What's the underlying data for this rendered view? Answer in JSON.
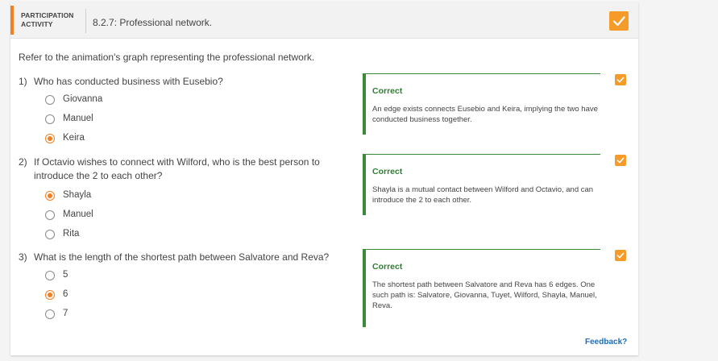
{
  "header": {
    "participation_line1": "PARTICIPATION",
    "participation_line2": "ACTIVITY",
    "title": "8.2.7: Professional network."
  },
  "intro": "Refer to the animation's graph representing the professional network.",
  "questions": [
    {
      "number": "1)",
      "text": "Who has conducted business with Eusebio?",
      "options": [
        {
          "label": "Giovanna",
          "selected": false
        },
        {
          "label": "Manuel",
          "selected": false
        },
        {
          "label": "Keira",
          "selected": true
        }
      ],
      "feedback": {
        "title": "Correct",
        "body": "An edge exists connects Eusebio and Keira, implying the two have conducted business together."
      }
    },
    {
      "number": "2)",
      "text": "If Octavio wishes to connect with Wilford, who is the best person to introduce the 2 to each other?",
      "options": [
        {
          "label": "Shayla",
          "selected": true
        },
        {
          "label": "Manuel",
          "selected": false
        },
        {
          "label": "Rita",
          "selected": false
        }
      ],
      "feedback": {
        "title": "Correct",
        "body": "Shayla is a mutual contact between Wilford and Octavio, and can introduce the 2 to each other."
      }
    },
    {
      "number": "3)",
      "text": "What is the length of the shortest path between Salvatore and Reva?",
      "options": [
        {
          "label": "5",
          "selected": false
        },
        {
          "label": "6",
          "selected": true
        },
        {
          "label": "7",
          "selected": false
        }
      ],
      "feedback": {
        "title": "Correct",
        "body": "The shortest path between Salvatore and Reva has 6 edges. One such path is: Salvatore, Giovanna, Tuyet, Wilford, Shayla, Manuel, Reva."
      }
    }
  ],
  "feedback_link": "Feedback?",
  "colors": {
    "accent": "#f47e20",
    "check": "#f59b2a",
    "correct": "#2e7d32",
    "link": "#1e6db5"
  }
}
